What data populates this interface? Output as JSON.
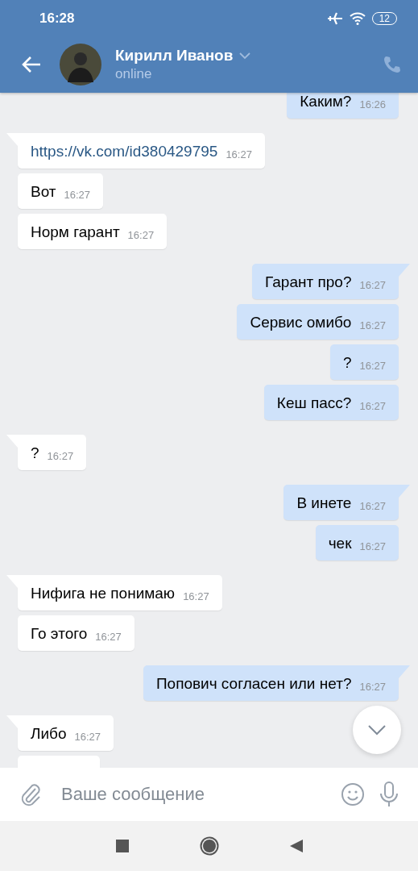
{
  "status_bar": {
    "time": "16:28",
    "battery": "12"
  },
  "header": {
    "name": "Кирилл Иванов",
    "status": "online"
  },
  "messages": [
    {
      "outgoing": true,
      "kind": "text",
      "text": "Каким?",
      "time": "16:26",
      "tail": false
    },
    {
      "outgoing": false,
      "kind": "link",
      "text": "https://vk.com/id380429795",
      "time": "16:27",
      "tail": true
    },
    {
      "outgoing": false,
      "kind": "text",
      "text": "Вот",
      "time": "16:27",
      "tail": false
    },
    {
      "outgoing": false,
      "kind": "text",
      "text": "Норм гарант",
      "time": "16:27",
      "tail": false
    },
    {
      "outgoing": true,
      "kind": "text",
      "text": "Гарант про?",
      "time": "16:27",
      "tail": true
    },
    {
      "outgoing": true,
      "kind": "text",
      "text": "Сервис омибо",
      "time": "16:27",
      "tail": false
    },
    {
      "outgoing": true,
      "kind": "text",
      "text": "?",
      "time": "16:27",
      "tail": false
    },
    {
      "outgoing": true,
      "kind": "text",
      "text": "Кеш пасс?",
      "time": "16:27",
      "tail": false
    },
    {
      "outgoing": false,
      "kind": "text",
      "text": "?",
      "time": "16:27",
      "tail": true
    },
    {
      "outgoing": true,
      "kind": "text",
      "text": "В инете",
      "time": "16:27",
      "tail": true
    },
    {
      "outgoing": true,
      "kind": "text",
      "text": "чек",
      "time": "16:27",
      "tail": false
    },
    {
      "outgoing": false,
      "kind": "text",
      "text": "Нифига не понимаю",
      "time": "16:27",
      "tail": true
    },
    {
      "outgoing": false,
      "kind": "text",
      "text": "Го этого",
      "time": "16:27",
      "tail": false
    },
    {
      "outgoing": true,
      "kind": "text",
      "text": "Попович согласен или нет?",
      "time": "16:27",
      "tail": true
    },
    {
      "outgoing": false,
      "kind": "text",
      "text": "Либо",
      "time": "16:27",
      "tail": true
    },
    {
      "outgoing": false,
      "kind": "text",
      "tail": false
    }
  ],
  "composer": {
    "placeholder": "Ваше сообщение"
  }
}
